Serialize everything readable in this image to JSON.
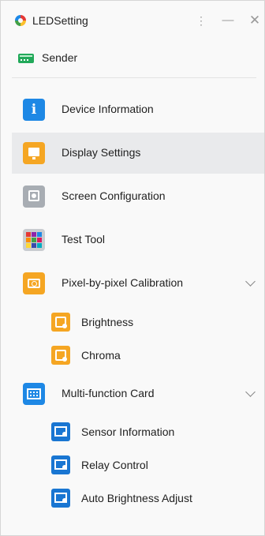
{
  "window": {
    "title": "LEDSetting",
    "more_icon": "⋮",
    "minimize_icon": "—",
    "close_icon": "✕"
  },
  "sender": {
    "label": "Sender"
  },
  "menu": {
    "device_info": "Device Information",
    "display_settings": "Display Settings",
    "screen_config": "Screen Configuration",
    "test_tool": "Test Tool",
    "pixel_calibration": "Pixel-by-pixel Calibration",
    "brightness": "Brightness",
    "chroma": "Chroma",
    "multi_function_card": "Multi-function Card",
    "sensor_info": "Sensor Information",
    "relay_control": "Relay Control",
    "auto_brightness": "Auto Brightness Adjust"
  },
  "colors": {
    "accent_blue": "#1e88e5",
    "accent_orange": "#f5a623",
    "sender_green": "#22a95a",
    "selected_bg": "#e9eaec"
  }
}
